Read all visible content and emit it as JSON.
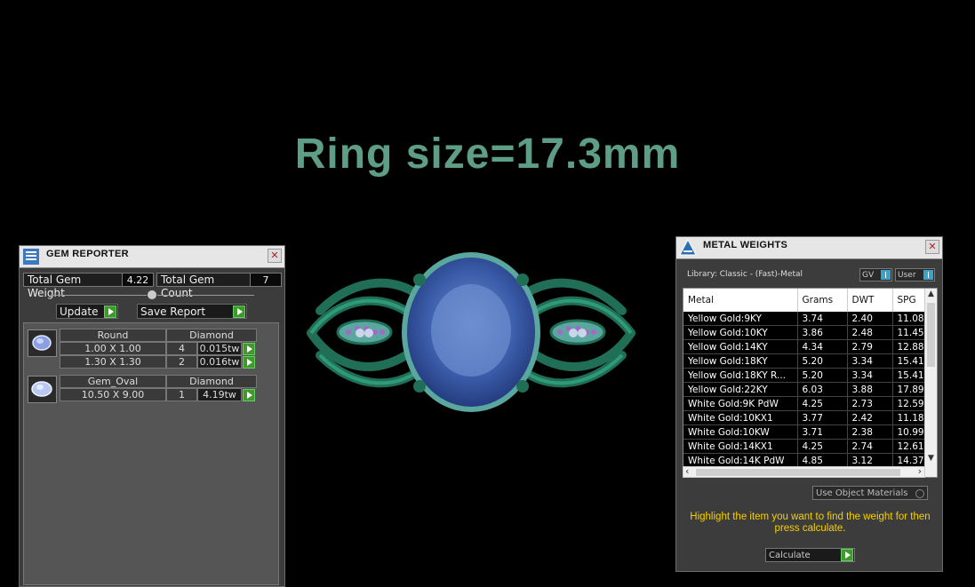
{
  "headline": "Ring size=17.3mm",
  "gem_reporter": {
    "title": "GEM REPORTER",
    "total_weight_label": "Total Gem Weight",
    "total_weight_value": "4.22",
    "total_count_label": "Total Gem Count",
    "total_count_value": "7",
    "update_label": "Update",
    "save_report_label": "Save Report",
    "groups": [
      {
        "shape": "Round",
        "material": "Diamond",
        "rows": [
          {
            "size": "1.00 X 1.00",
            "count": "4",
            "weight": "0.015tw"
          },
          {
            "size": "1.30 X 1.30",
            "count": "2",
            "weight": "0.016tw"
          }
        ]
      },
      {
        "shape": "Gem_Oval",
        "material": "Diamond",
        "rows": [
          {
            "size": "10.50 X 9.00",
            "count": "1",
            "weight": "4.19tw"
          }
        ]
      }
    ]
  },
  "metal_weights": {
    "title": "METAL WEIGHTS",
    "library_label": "Library: Classic - (Fast)-Metal",
    "gv_label": "GV",
    "user_label": "User",
    "columns": [
      "Metal",
      "Grams",
      "DWT",
      "SPG"
    ],
    "rows": [
      [
        "Yellow Gold:9KY",
        "3.74",
        "2.40",
        "11.08"
      ],
      [
        "Yellow Gold:10KY",
        "3.86",
        "2.48",
        "11.45"
      ],
      [
        "Yellow Gold:14KY",
        "4.34",
        "2.79",
        "12.88"
      ],
      [
        "Yellow Gold:18KY",
        "5.20",
        "3.34",
        "15.41"
      ],
      [
        "Yellow Gold:18KY R...",
        "5.20",
        "3.34",
        "15.41"
      ],
      [
        "Yellow Gold:22KY",
        "6.03",
        "3.88",
        "17.89"
      ],
      [
        "White Gold:9K PdW",
        "4.25",
        "2.73",
        "12.59"
      ],
      [
        "White Gold:10KX1",
        "3.77",
        "2.42",
        "11.18"
      ],
      [
        "White Gold:10KW",
        "3.71",
        "2.38",
        "10.99"
      ],
      [
        "White Gold:14KX1",
        "4.25",
        "2.74",
        "12.61"
      ],
      [
        "White Gold:14K PdW",
        "4.85",
        "3.12",
        "14.37"
      ]
    ],
    "use_object_label": "Use Object Materials",
    "hint": "Highlight the item you want to find the weight for then press calculate.",
    "calculate_label": "Calculate"
  }
}
